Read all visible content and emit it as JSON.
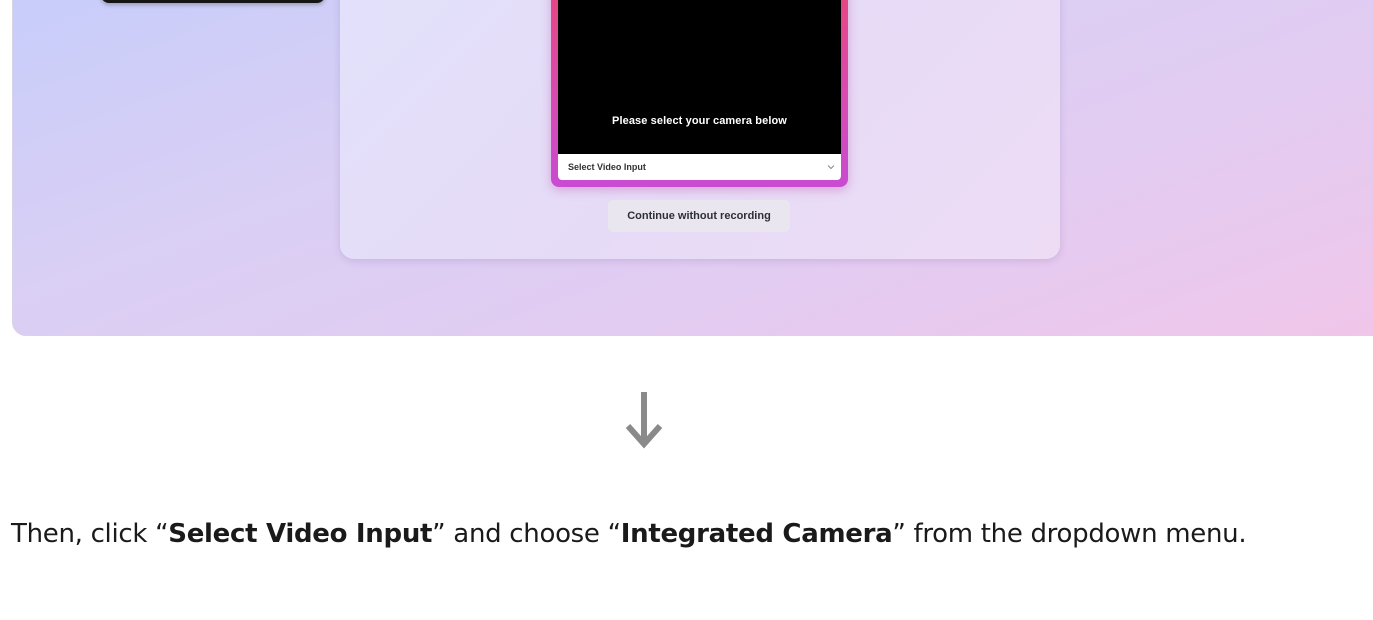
{
  "camera": {
    "message": "Please select your camera below",
    "select_label": "Select Video Input",
    "chevron_icon": "chevron-down-icon"
  },
  "buttons": {
    "continue_label": "Continue without recording"
  },
  "arrow": {
    "icon": "arrow-down-icon",
    "color": "#8a8a8a"
  },
  "instruction": {
    "part1": "Then, click “",
    "bold1": "Select Video Input",
    "part2": "” and choose “",
    "bold2": "Integrated Camera",
    "part3": "” from the dropdown menu."
  },
  "colors": {
    "camera_border_top": "#e9457c",
    "camera_border_bottom": "#c84bd2",
    "background_gradient": [
      "#c6cdfb",
      "#f0c6ea"
    ]
  }
}
